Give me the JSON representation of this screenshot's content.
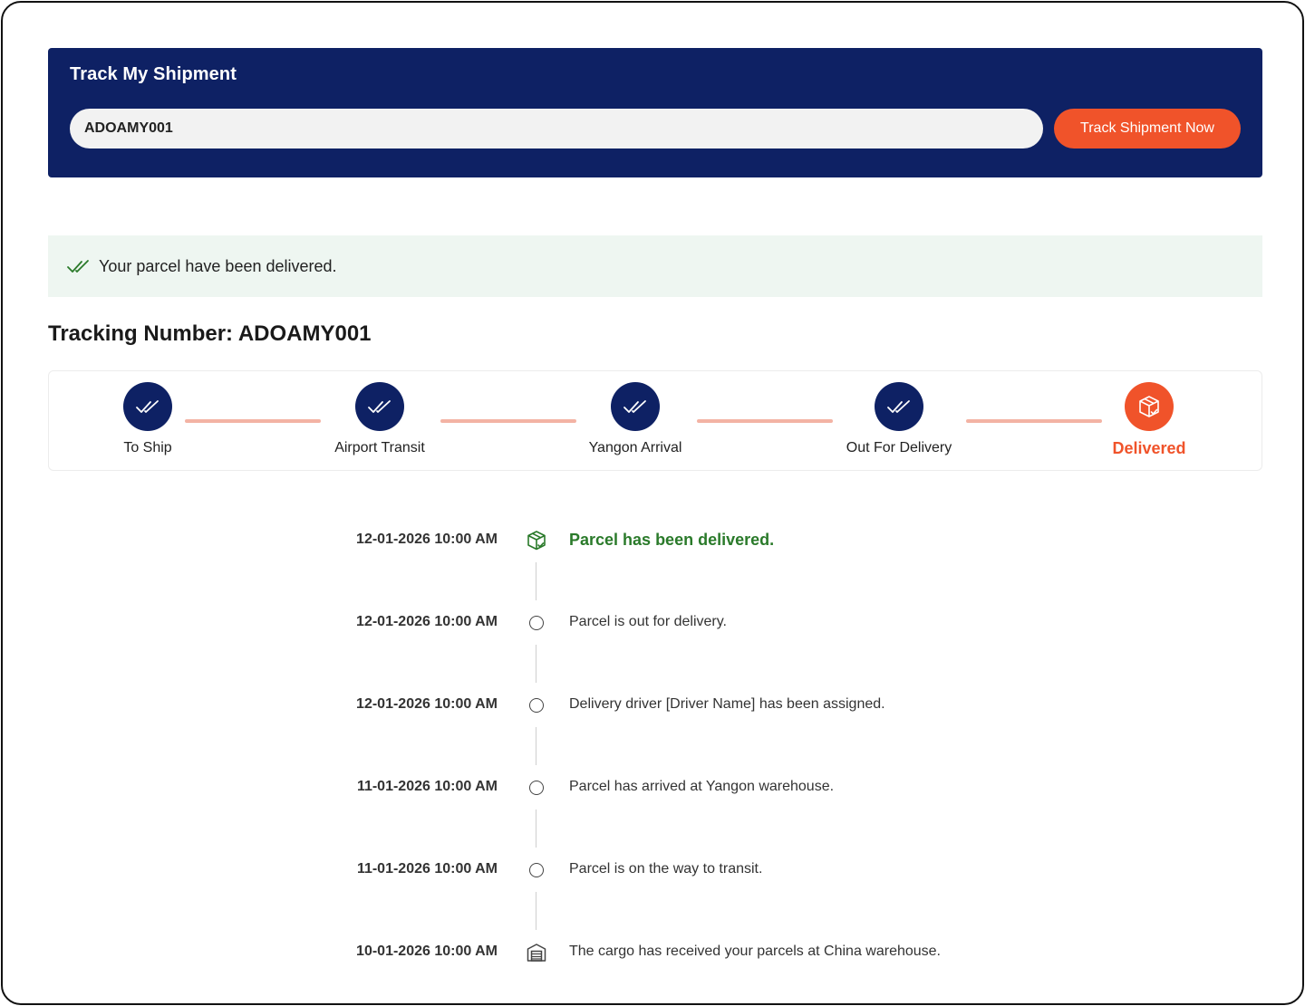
{
  "header": {
    "title": "Track My Shipment",
    "input_value": "ADOAMY001",
    "button_label": "Track Shipment Now"
  },
  "alert": {
    "message": "Your parcel have been delivered.",
    "icon": "double-check-icon"
  },
  "tracking": {
    "heading": "Tracking Number: ADOAMY001"
  },
  "steps": [
    {
      "label": "To Ship",
      "icon": "double-check-icon",
      "state": "done"
    },
    {
      "label": "Airport Transit",
      "icon": "double-check-icon",
      "state": "done"
    },
    {
      "label": "Yangon Arrival",
      "icon": "double-check-icon",
      "state": "done"
    },
    {
      "label": "Out For Delivery",
      "icon": "double-check-icon",
      "state": "done"
    },
    {
      "label": "Delivered",
      "icon": "package-check-icon",
      "state": "active"
    }
  ],
  "timeline": [
    {
      "date": "12-01-2026 10:00 AM",
      "text": "Parcel has been delivered.",
      "icon": "package-check-icon"
    },
    {
      "date": "12-01-2026 10:00 AM",
      "text": "Parcel is out for delivery.",
      "icon": "circle-icon"
    },
    {
      "date": "12-01-2026 10:00 AM",
      "text": "Delivery driver [Driver Name] has been assigned.",
      "icon": "circle-icon"
    },
    {
      "date": "11-01-2026 10:00 AM",
      "text": "Parcel has arrived at Yangon warehouse.",
      "icon": "circle-icon"
    },
    {
      "date": "11-01-2026 10:00 AM",
      "text": "Parcel is on the way to transit.",
      "icon": "circle-icon"
    },
    {
      "date": "10-01-2026 10:00 AM",
      "text": "The cargo has received your parcels at China warehouse.",
      "icon": "warehouse-icon"
    }
  ],
  "colors": {
    "navy": "#0e2164",
    "accent": "#f0532a",
    "connector": "#f3b3a4",
    "success": "#2a7a2a",
    "alert_bg": "#eef6f1"
  }
}
